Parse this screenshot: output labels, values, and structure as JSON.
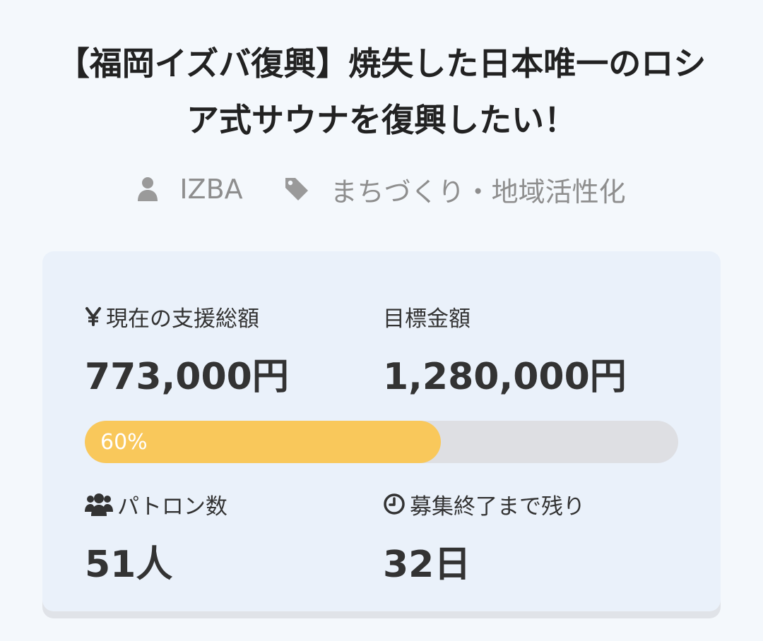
{
  "project": {
    "title": "【福岡イズバ復興】焼失した日本唯一のロシア式サウナを復興したい！",
    "owner": "IZBA",
    "category": "まちづくり・地域活性化",
    "owner_icon": "user-icon",
    "category_icon": "tag-icon"
  },
  "stats": {
    "raised_label": "現在の支援総額",
    "raised_icon": "yen-icon",
    "raised_value": "773,000円",
    "goal_label": "目標金額",
    "goal_value": "1,280,000円",
    "progress_fraction": 0.6,
    "progress_text": "60%",
    "patrons_label": "パトロン数",
    "patrons_icon": "users-icon",
    "patrons_value": "51人",
    "remaining_label": "募集終了まで残り",
    "remaining_icon": "clock-icon",
    "remaining_value": "32日"
  },
  "colors": {
    "background": "#f4f8fc",
    "card_background": "#eaf1fa",
    "progress_fill": "#f9c85b",
    "progress_track": "#dedfe3",
    "meta_text": "#8e8e8e",
    "primary_text": "#333333"
  }
}
